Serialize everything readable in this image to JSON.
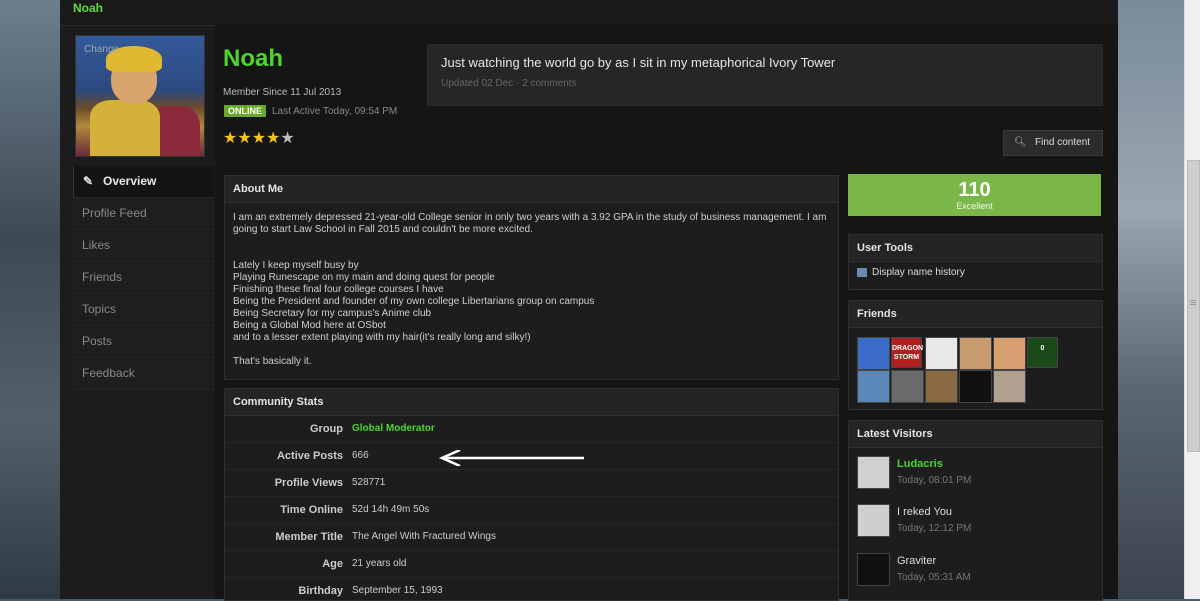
{
  "breadcrumb": "Noah",
  "profile": {
    "change_label": "Change",
    "name": "Noah",
    "member_since": "Member Since 11 Jul 2013",
    "online_badge": "ONLINE",
    "last_active": "Last Active Today, 09:54 PM",
    "rating_stars": 4,
    "rating_max": 5
  },
  "status": {
    "text": "Just watching the world go by as I sit in my metaphorical Ivory Tower",
    "meta": "Updated 02 Dec · 2 comments"
  },
  "find_content_label": "Find content",
  "sidenav": {
    "items": [
      {
        "label": "Overview"
      },
      {
        "label": "Profile Feed"
      },
      {
        "label": "Likes"
      },
      {
        "label": "Friends"
      },
      {
        "label": "Topics"
      },
      {
        "label": "Posts"
      },
      {
        "label": "Feedback"
      }
    ]
  },
  "about": {
    "title": "About Me",
    "p1": "I am an extremely depressed 21-year-old College senior in only two years with a 3.92 GPA in the study of business management. I am going to start Law School in Fall 2015 and couldn't be more excited.",
    "lines": [
      "Lately I keep myself busy by",
      "Playing Runescape on my main and doing quest for people",
      "Finishing these final four college courses I have",
      "Being the President and founder of my own college Libertarians group on campus",
      "Being Secretary for my campus's Anime club",
      "Being a Global Mod here at OSbot",
      "and to a lesser extent playing with my hair(it's really long and silky!)"
    ],
    "closing": "That's basically it."
  },
  "stats": {
    "title": "Community Stats",
    "rows": [
      {
        "label": "Group",
        "value": "Global Moderator"
      },
      {
        "label": "Active Posts",
        "value": "666"
      },
      {
        "label": "Profile Views",
        "value": "528771"
      },
      {
        "label": "Time Online",
        "value": "52d 14h 49m 50s"
      },
      {
        "label": "Member Title",
        "value": "The Angel With Fractured Wings"
      },
      {
        "label": "Age",
        "value": "21 years old"
      },
      {
        "label": "Birthday",
        "value": "September 15, 1993"
      }
    ]
  },
  "reputation": {
    "value": "110",
    "label": "Excellent"
  },
  "user_tools": {
    "title": "User Tools",
    "link": "Display name history"
  },
  "friends": {
    "title": "Friends",
    "thumbs": [
      {
        "color": "#3a6cc8",
        "text": ""
      },
      {
        "color": "#b02020",
        "text": "DRAGON STORM"
      },
      {
        "color": "#e8e8e8",
        "text": ""
      },
      {
        "color": "#c89a70",
        "text": ""
      },
      {
        "color": "#d8a070",
        "text": ""
      },
      {
        "color": "#1a4a1a",
        "text": "0"
      },
      {
        "color": "#5a88b8",
        "text": ""
      },
      {
        "color": "#6a6a6a",
        "text": ""
      },
      {
        "color": "#8a6a40",
        "text": ""
      },
      {
        "color": "#111111",
        "text": ""
      },
      {
        "color": "#b0a090",
        "text": ""
      }
    ]
  },
  "visitors": {
    "title": "Latest Visitors",
    "items": [
      {
        "name": "Ludacris",
        "time": "Today, 08:01 PM"
      },
      {
        "name": "I reked You",
        "time": "Today, 12:12 PM"
      },
      {
        "name": "Graviter",
        "time": "Today, 05:31 AM"
      }
    ]
  }
}
